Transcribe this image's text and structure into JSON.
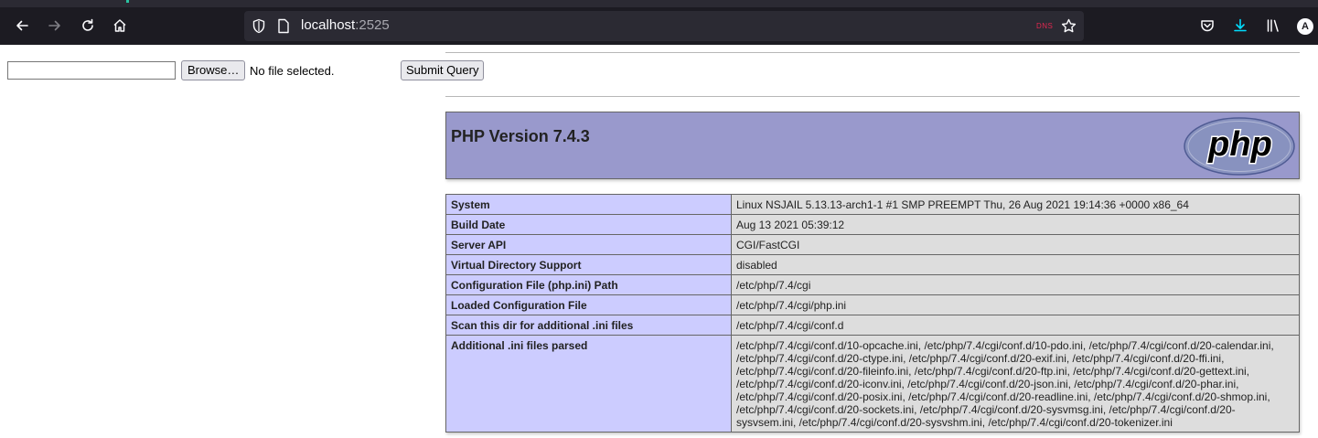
{
  "browser": {
    "url_host": "localhost",
    "url_port": ":2525",
    "dns_badge": "DNS",
    "profile_initial": "A",
    "icons": {
      "back": "arrow-left-icon",
      "forward": "arrow-right-icon",
      "reload": "reload-icon",
      "home": "home-icon",
      "tracking": "shield-icon",
      "page_info": "page-icon",
      "bookmark": "star-icon",
      "pocket": "pocket-icon",
      "downloads": "download-icon",
      "library": "library-icon"
    },
    "colors": {
      "toolbar": "#1c1b22",
      "urlbar": "#2b2a33",
      "download_accent": "#00ddff"
    }
  },
  "form": {
    "file_value": "",
    "browse_label": "Browse…",
    "no_file_text": "No file selected.",
    "submit_label": "Submit Query"
  },
  "phpinfo": {
    "title": "PHP Version 7.4.3",
    "logo_text": "php",
    "colors": {
      "header_bg": "#9999cc",
      "key_bg": "#ccccff",
      "value_bg": "#dddddd"
    },
    "rows": [
      {
        "key": "System",
        "value": "Linux NSJAIL 5.13.13-arch1-1 #1 SMP PREEMPT Thu, 26 Aug 2021 19:14:36 +0000 x86_64"
      },
      {
        "key": "Build Date",
        "value": "Aug 13 2021 05:39:12"
      },
      {
        "key": "Server API",
        "value": "CGI/FastCGI"
      },
      {
        "key": "Virtual Directory Support",
        "value": "disabled"
      },
      {
        "key": "Configuration File (php.ini) Path",
        "value": "/etc/php/7.4/cgi"
      },
      {
        "key": "Loaded Configuration File",
        "value": "/etc/php/7.4/cgi/php.ini"
      },
      {
        "key": "Scan this dir for additional .ini files",
        "value": "/etc/php/7.4/cgi/conf.d"
      },
      {
        "key": "Additional .ini files parsed",
        "value": "/etc/php/7.4/cgi/conf.d/10-opcache.ini, /etc/php/7.4/cgi/conf.d/10-pdo.ini, /etc/php/7.4/cgi/conf.d/20-calendar.ini, /etc/php/7.4/cgi/conf.d/20-ctype.ini, /etc/php/7.4/cgi/conf.d/20-exif.ini, /etc/php/7.4/cgi/conf.d/20-ffi.ini, /etc/php/7.4/cgi/conf.d/20-fileinfo.ini, /etc/php/7.4/cgi/conf.d/20-ftp.ini, /etc/php/7.4/cgi/conf.d/20-gettext.ini, /etc/php/7.4/cgi/conf.d/20-iconv.ini, /etc/php/7.4/cgi/conf.d/20-json.ini, /etc/php/7.4/cgi/conf.d/20-phar.ini, /etc/php/7.4/cgi/conf.d/20-posix.ini, /etc/php/7.4/cgi/conf.d/20-readline.ini, /etc/php/7.4/cgi/conf.d/20-shmop.ini, /etc/php/7.4/cgi/conf.d/20-sockets.ini, /etc/php/7.4/cgi/conf.d/20-sysvmsg.ini, /etc/php/7.4/cgi/conf.d/20-sysvsem.ini, /etc/php/7.4/cgi/conf.d/20-sysvshm.ini, /etc/php/7.4/cgi/conf.d/20-tokenizer.ini"
      }
    ]
  }
}
